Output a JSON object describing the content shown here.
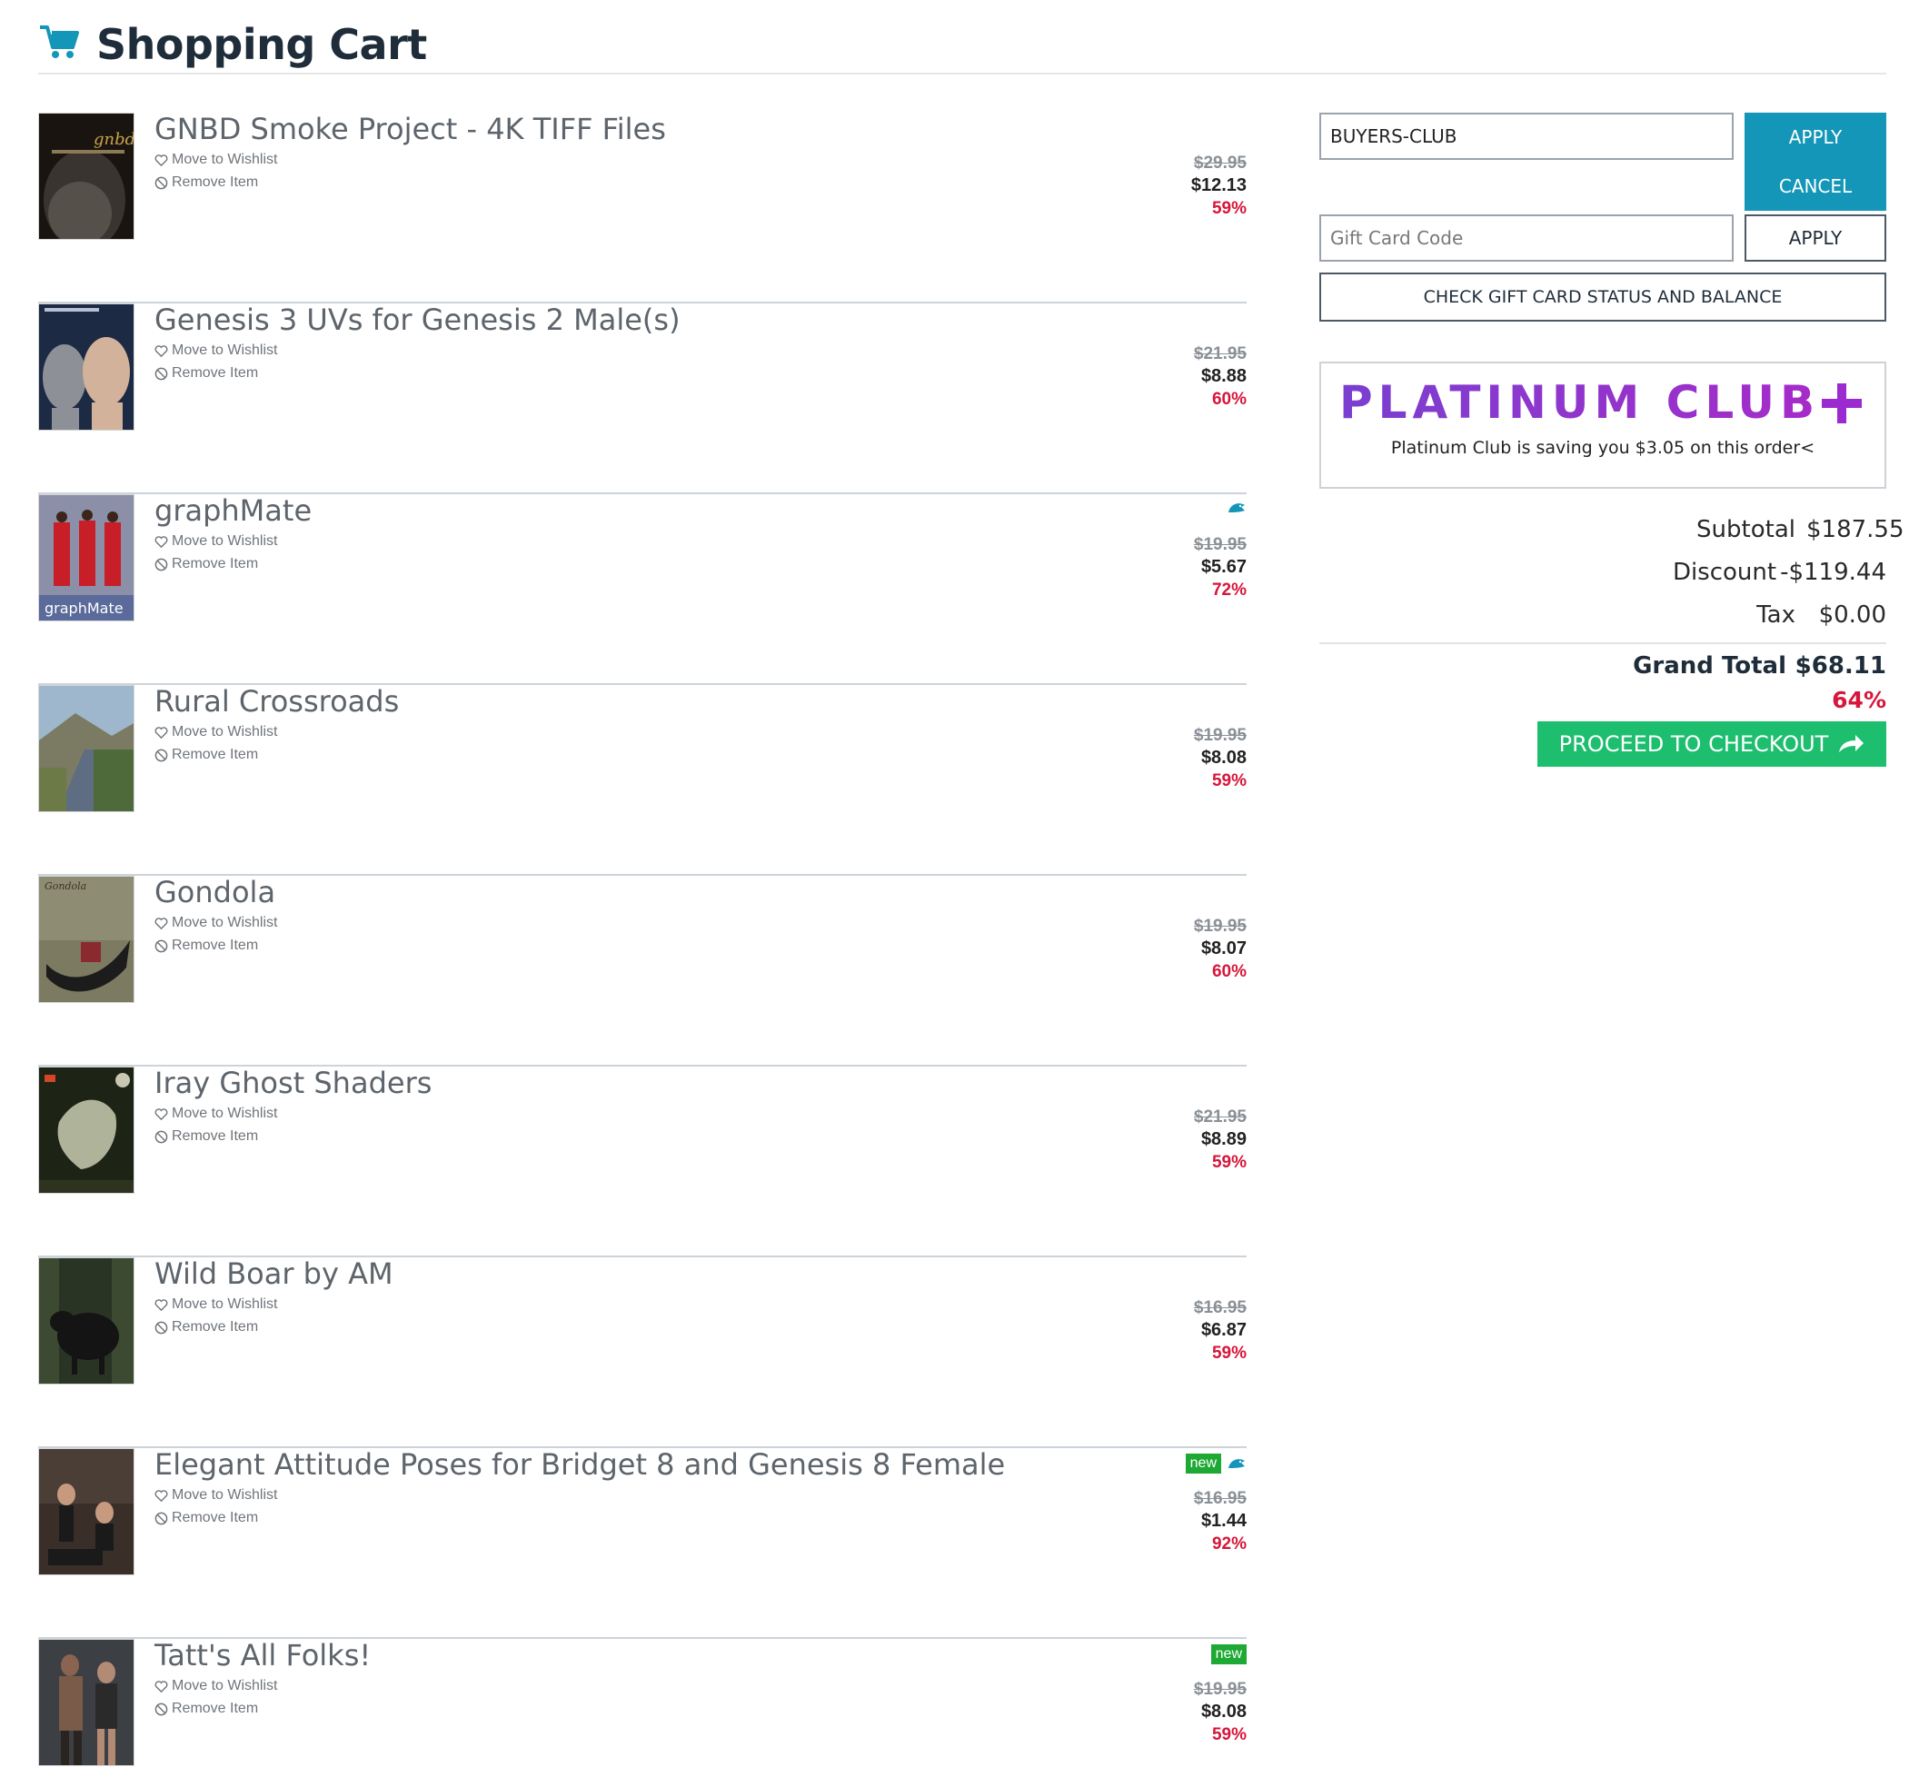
{
  "header": {
    "title": "Shopping Cart",
    "icon": "shopping-cart-icon",
    "icon_color": "#1396b7"
  },
  "items": [
    {
      "title": "GNBD Smoke Project - 4K TIFF Files",
      "wishlist": "Move to Wishlist",
      "remove": "Remove Item",
      "old_price": "$29.95",
      "price": "$12.13",
      "percent": "59%",
      "new_badge": "",
      "fish": false
    },
    {
      "title": "Genesis 3 UVs for Genesis 2 Male(s)",
      "wishlist": "Move to Wishlist",
      "remove": "Remove Item",
      "old_price": "$21.95",
      "price": "$8.88",
      "percent": "60%",
      "new_badge": "",
      "fish": false
    },
    {
      "title": "graphMate",
      "wishlist": "Move to Wishlist",
      "remove": "Remove Item",
      "old_price": "$19.95",
      "price": "$5.67",
      "percent": "72%",
      "new_badge": "",
      "fish": true,
      "thumb_caption": "graphMate"
    },
    {
      "title": "Rural Crossroads",
      "wishlist": "Move to Wishlist",
      "remove": "Remove Item",
      "old_price": "$19.95",
      "price": "$8.08",
      "percent": "59%",
      "new_badge": "",
      "fish": false
    },
    {
      "title": "Gondola",
      "wishlist": "Move to Wishlist",
      "remove": "Remove Item",
      "old_price": "$19.95",
      "price": "$8.07",
      "percent": "60%",
      "new_badge": "",
      "fish": false
    },
    {
      "title": "Iray Ghost Shaders",
      "wishlist": "Move to Wishlist",
      "remove": "Remove Item",
      "old_price": "$21.95",
      "price": "$8.89",
      "percent": "59%",
      "new_badge": "",
      "fish": false
    },
    {
      "title": "Wild Boar by AM",
      "wishlist": "Move to Wishlist",
      "remove": "Remove Item",
      "old_price": "$16.95",
      "price": "$6.87",
      "percent": "59%",
      "new_badge": "",
      "fish": false
    },
    {
      "title": "Elegant Attitude Poses for Bridget 8 and Genesis 8 Female",
      "wishlist": "Move to Wishlist",
      "remove": "Remove Item",
      "old_price": "$16.95",
      "price": "$1.44",
      "percent": "92%",
      "new_badge": "new",
      "fish": true
    },
    {
      "title": "Tatt's All Folks!",
      "wishlist": "Move to Wishlist",
      "remove": "Remove Item",
      "old_price": "$19.95",
      "price": "$8.08",
      "percent": "59%",
      "new_badge": "new",
      "fish": false
    }
  ],
  "coupon": {
    "value": "BUYERS-CLUB",
    "apply_label": "APPLY",
    "cancel_label": "CANCEL"
  },
  "gift_card": {
    "placeholder": "Gift Card Code",
    "apply_label": "APPLY",
    "check_label": "CHECK GIFT CARD STATUS AND BALANCE"
  },
  "platinum": {
    "logo_text": "PLATINUM CLUB",
    "message": "Platinum Club is saving you $3.05 on this order<"
  },
  "totals": {
    "subtotal_label": "Subtotal",
    "subtotal": "$187.55",
    "discount_label": "Discount",
    "discount": "-$119.44",
    "tax_label": "Tax",
    "tax": "$0.00",
    "grand_label": "Grand Total",
    "grand": "$68.11",
    "grand_percent": "64%"
  },
  "checkout": {
    "label": "PROCEED TO CHECKOUT",
    "icon": "share-arrow-icon"
  },
  "colors": {
    "accent": "#1396b7",
    "checkout": "#1ebe6f",
    "discount_red": "#d6163a",
    "new_badge": "#1ea834",
    "platinum_purple": "#9b2bd1"
  }
}
